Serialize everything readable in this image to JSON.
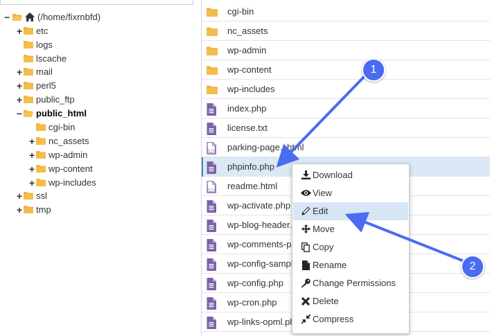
{
  "tree": {
    "root": "(/home/fixrnbfd)",
    "items": [
      {
        "label": "etc",
        "toggle": "+"
      },
      {
        "label": "logs",
        "toggle": ""
      },
      {
        "label": "lscache",
        "toggle": ""
      },
      {
        "label": "mail",
        "toggle": "+"
      },
      {
        "label": "perl5",
        "toggle": "+"
      },
      {
        "label": "public_ftp",
        "toggle": "+"
      },
      {
        "label": "public_html",
        "toggle": "−"
      },
      {
        "label": "cgi-bin",
        "toggle": ""
      },
      {
        "label": "nc_assets",
        "toggle": "+"
      },
      {
        "label": "wp-admin",
        "toggle": "+"
      },
      {
        "label": "wp-content",
        "toggle": "+"
      },
      {
        "label": "wp-includes",
        "toggle": "+"
      },
      {
        "label": "ssl",
        "toggle": "+"
      },
      {
        "label": "tmp",
        "toggle": "+"
      }
    ]
  },
  "files": [
    {
      "name": "cgi-bin",
      "icon": "folder-icon"
    },
    {
      "name": "nc_assets",
      "icon": "folder-icon"
    },
    {
      "name": "wp-admin",
      "icon": "folder-icon"
    },
    {
      "name": "wp-content",
      "icon": "folder-icon"
    },
    {
      "name": "wp-includes",
      "icon": "folder-icon"
    },
    {
      "name": "index.php",
      "icon": "php-file-icon"
    },
    {
      "name": "license.txt",
      "icon": "text-file-icon"
    },
    {
      "name": "parking-page.shtml",
      "icon": "code-file-icon"
    },
    {
      "name": "phpinfo.php",
      "icon": "php-file-icon"
    },
    {
      "name": "readme.html",
      "icon": "code-file-icon"
    },
    {
      "name": "wp-activate.php",
      "icon": "php-file-icon"
    },
    {
      "name": "wp-blog-header.php",
      "icon": "php-file-icon"
    },
    {
      "name": "wp-comments-post.php",
      "icon": "php-file-icon"
    },
    {
      "name": "wp-config-sample.php",
      "icon": "php-file-icon"
    },
    {
      "name": "wp-config.php",
      "icon": "php-file-icon"
    },
    {
      "name": "wp-cron.php",
      "icon": "php-file-icon"
    },
    {
      "name": "wp-links-opml.php",
      "icon": "php-file-icon"
    }
  ],
  "context_menu": {
    "items": [
      {
        "label": "Download",
        "icon": "download-icon"
      },
      {
        "label": "View",
        "icon": "eye-icon"
      },
      {
        "label": "Edit",
        "icon": "pencil-icon"
      },
      {
        "label": "Move",
        "icon": "move-icon"
      },
      {
        "label": "Copy",
        "icon": "copy-icon"
      },
      {
        "label": "Rename",
        "icon": "file-icon"
      },
      {
        "label": "Change Permissions",
        "icon": "key-icon"
      },
      {
        "label": "Delete",
        "icon": "x-icon"
      },
      {
        "label": "Compress",
        "icon": "compress-icon"
      }
    ]
  },
  "annotations": {
    "badge1": "1",
    "badge2": "2",
    "color": "#4a6cf0"
  },
  "colors": {
    "folder": "#f0b43c",
    "php_file": "#7a63a8",
    "selected_row": "#dbe9f6",
    "menu_highlight": "#d6e6f5"
  }
}
